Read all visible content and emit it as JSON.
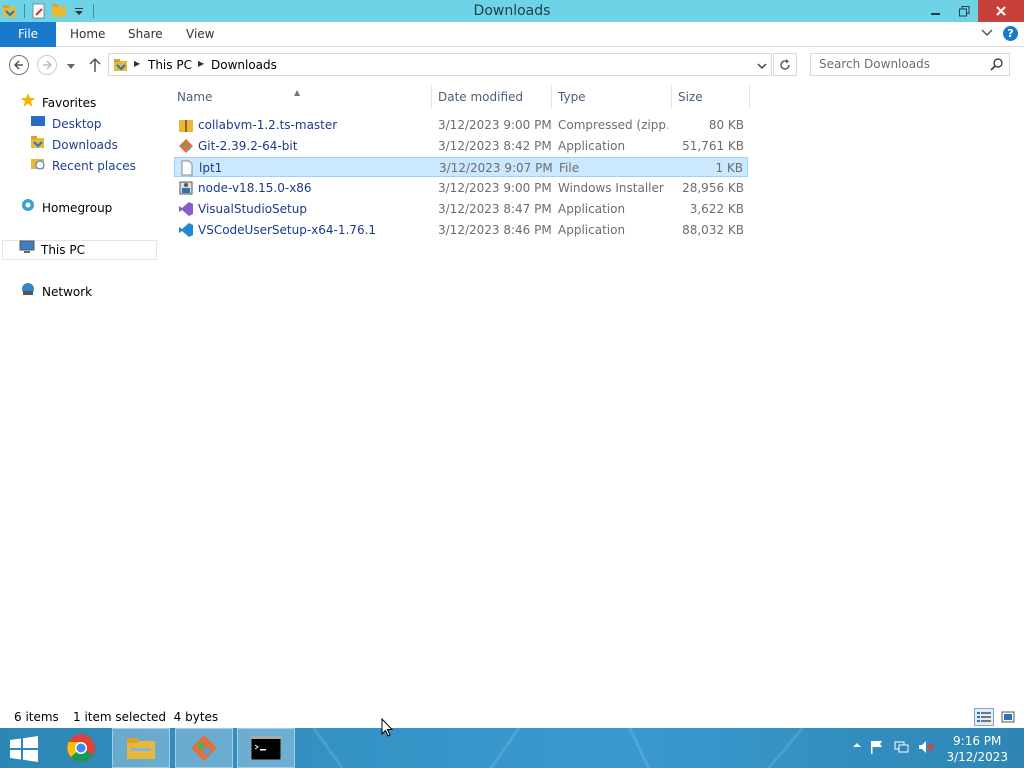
{
  "window": {
    "title": "Downloads"
  },
  "ribbon": {
    "tabs": [
      {
        "label": "File"
      },
      {
        "label": "Home"
      },
      {
        "label": "Share"
      },
      {
        "label": "View"
      }
    ]
  },
  "address": {
    "crumbs": [
      "This PC",
      "Downloads"
    ]
  },
  "search": {
    "placeholder": "Search Downloads"
  },
  "nav": {
    "favorites": "Favorites",
    "favorites_items": [
      "Desktop",
      "Downloads",
      "Recent places"
    ],
    "homegroup": "Homegroup",
    "thispc": "This PC",
    "network": "Network"
  },
  "columns": {
    "name": "Name",
    "date": "Date modified",
    "type": "Type",
    "size": "Size"
  },
  "files": [
    {
      "name": "collabvm-1.2.ts-master",
      "date": "3/12/2023 9:00 PM",
      "type": "Compressed (zipp...",
      "size": "80 KB",
      "icon": "zip-folder-icon"
    },
    {
      "name": "Git-2.39.2-64-bit",
      "date": "3/12/2023 8:42 PM",
      "type": "Application",
      "size": "51,761 KB",
      "icon": "git-icon"
    },
    {
      "name": "lpt1",
      "date": "3/12/2023 9:07 PM",
      "type": "File",
      "size": "1 KB",
      "icon": "file-icon",
      "selected": true
    },
    {
      "name": "node-v18.15.0-x86",
      "date": "3/12/2023 9:00 PM",
      "type": "Windows Installer ...",
      "size": "28,956 KB",
      "icon": "installer-icon"
    },
    {
      "name": "VisualStudioSetup",
      "date": "3/12/2023 8:47 PM",
      "type": "Application",
      "size": "3,622 KB",
      "icon": "visual-studio-icon"
    },
    {
      "name": "VSCodeUserSetup-x64-1.76.1",
      "date": "3/12/2023 8:46 PM",
      "type": "Application",
      "size": "88,032 KB",
      "icon": "vscode-icon"
    }
  ],
  "status": {
    "count": "6 items",
    "selection": "1 item selected  4 bytes"
  },
  "taskbar": {
    "time": "9:16 PM",
    "date": "3/12/2023"
  },
  "colors": {
    "titlebar": "#6ed3e6",
    "file_tab": "#1979ca",
    "selection": "#cce8ff",
    "link_text": "#1b3a8f",
    "taskbar": "#2d87b6"
  }
}
